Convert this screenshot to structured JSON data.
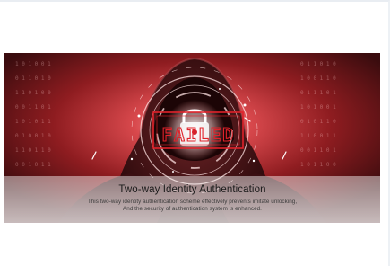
{
  "banner": {
    "overlay_text": "FAILED",
    "title": "Two-way Identity Authentication",
    "description_line1": "This two-way identity authentication scheme effectively prevents imitate unlocking,",
    "description_line2": "And the security of authentication system is enhanced.",
    "accent_color": "#d4242c"
  }
}
